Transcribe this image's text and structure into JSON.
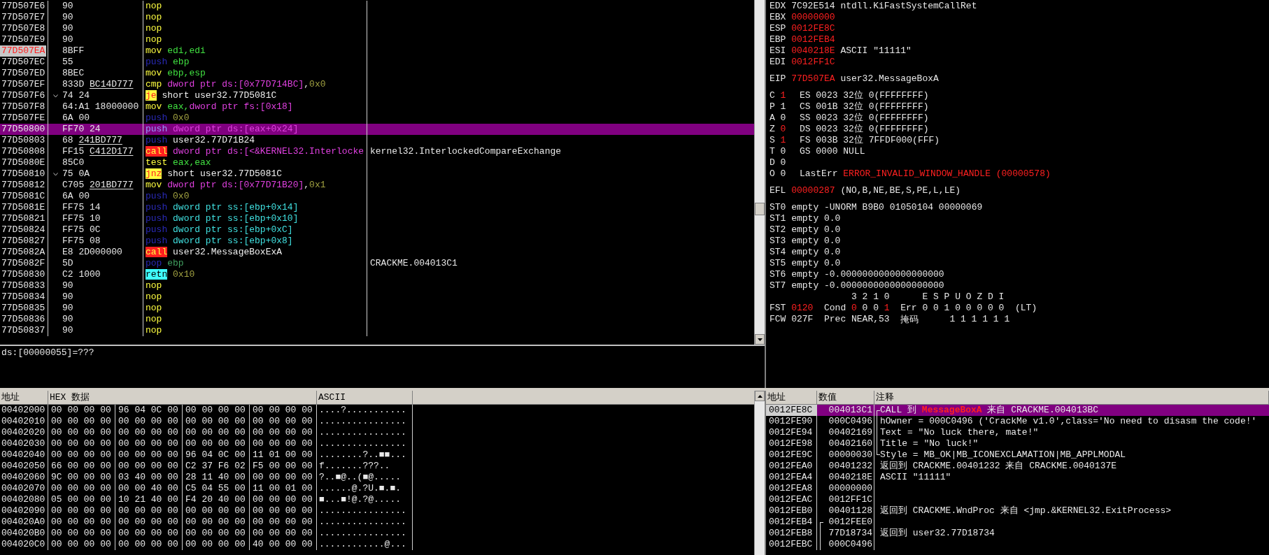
{
  "disassembly": [
    {
      "address": "77D507E6",
      "hex": [
        {
          "text": "90",
          "underline": false
        }
      ],
      "jump_mark": false,
      "eip": false,
      "selected": false,
      "mnemonic": {
        "text": "nop",
        "kind": "op"
      }
    },
    {
      "address": "77D507E7",
      "hex": [
        {
          "text": "90",
          "underline": false
        }
      ],
      "jump_mark": false,
      "eip": false,
      "selected": false,
      "mnemonic": {
        "text": "nop",
        "kind": "op"
      }
    },
    {
      "address": "77D507E8",
      "hex": [
        {
          "text": "90",
          "underline": false
        }
      ],
      "jump_mark": false,
      "eip": false,
      "selected": false,
      "mnemonic": {
        "text": "nop",
        "kind": "op"
      }
    },
    {
      "address": "77D507E9",
      "hex": [
        {
          "text": "90",
          "underline": false
        }
      ],
      "jump_mark": false,
      "eip": false,
      "selected": false,
      "mnemonic": {
        "text": "nop",
        "kind": "op"
      }
    },
    {
      "address": "77D507EA",
      "hex": [
        {
          "text": "8BFF",
          "underline": false
        }
      ],
      "jump_mark": false,
      "eip": true,
      "selected": false,
      "mnemonic": {
        "text": "mov",
        "kind": "op"
      },
      "operands": [
        {
          "text": "edi,edi",
          "kind": "reg"
        }
      ]
    },
    {
      "address": "77D507EC",
      "hex": [
        {
          "text": "55",
          "underline": false
        }
      ],
      "jump_mark": false,
      "eip": false,
      "selected": false,
      "mnemonic": {
        "text": "push",
        "kind": "stack"
      },
      "operands": [
        {
          "text": "ebp",
          "kind": "reg"
        }
      ]
    },
    {
      "address": "77D507ED",
      "hex": [
        {
          "text": "8BEC",
          "underline": false
        }
      ],
      "jump_mark": false,
      "eip": false,
      "selected": false,
      "mnemonic": {
        "text": "mov",
        "kind": "op"
      },
      "operands": [
        {
          "text": "ebp,esp",
          "kind": "reg"
        }
      ]
    },
    {
      "address": "77D507EF",
      "hex": [
        {
          "text": "833D",
          "underline": false
        },
        {
          "text": "BC14D777",
          "underline": true
        }
      ],
      "jump_mark": false,
      "eip": false,
      "selected": false,
      "mnemonic": {
        "text": "cmp",
        "kind": "op"
      },
      "operands": [
        {
          "text": "dword ptr ds:[0x77D714BC]",
          "kind": "mem"
        },
        {
          "text": ",",
          "kind": "plain"
        },
        {
          "text": "0x0",
          "kind": "const"
        }
      ]
    },
    {
      "address": "77D507F6",
      "hex": [
        {
          "text": "74 24",
          "underline": false
        }
      ],
      "jump_mark": true,
      "eip": false,
      "selected": false,
      "mnemonic": {
        "text": "je",
        "kind": "jump"
      },
      "operands": [
        {
          "text": "short user32.77D5081C",
          "kind": "label"
        }
      ]
    },
    {
      "address": "77D507F8",
      "hex": [
        {
          "text": "64:A1 18000000",
          "underline": false
        }
      ],
      "jump_mark": false,
      "eip": false,
      "selected": false,
      "mnemonic": {
        "text": "mov",
        "kind": "op"
      },
      "operands": [
        {
          "text": "eax,",
          "kind": "reg"
        },
        {
          "text": "dword ptr fs:[0x18]",
          "kind": "mem"
        }
      ]
    },
    {
      "address": "77D507FE",
      "hex": [
        {
          "text": "6A 00",
          "underline": false
        }
      ],
      "jump_mark": false,
      "eip": false,
      "selected": false,
      "mnemonic": {
        "text": "push",
        "kind": "stack"
      },
      "operands": [
        {
          "text": "0x0",
          "kind": "const"
        }
      ]
    },
    {
      "address": "77D50800",
      "hex": [
        {
          "text": "FF70 24",
          "underline": false
        }
      ],
      "jump_mark": false,
      "eip": false,
      "selected": true,
      "mnemonic": {
        "text": "push",
        "kind": "stack"
      },
      "operands": [
        {
          "text": "dword ptr ds:[eax+0x24]",
          "kind": "mem"
        }
      ]
    },
    {
      "address": "77D50803",
      "hex": [
        {
          "text": "68",
          "underline": false
        },
        {
          "text": "241BD777",
          "underline": true
        }
      ],
      "jump_mark": false,
      "eip": false,
      "selected": false,
      "mnemonic": {
        "text": "push",
        "kind": "stack"
      },
      "operands": [
        {
          "text": "user32.77D71B24",
          "kind": "label"
        }
      ]
    },
    {
      "address": "77D50808",
      "hex": [
        {
          "text": "FF15",
          "underline": false
        },
        {
          "text": "C412D177",
          "underline": true
        }
      ],
      "jump_mark": false,
      "eip": false,
      "selected": false,
      "mnemonic": {
        "text": "call",
        "kind": "call"
      },
      "operands": [
        {
          "text": "dword ptr ds:[<&KERNEL32.Interlocke",
          "kind": "mem"
        }
      ],
      "comment": "kernel32.InterlockedCompareExchange"
    },
    {
      "address": "77D5080E",
      "hex": [
        {
          "text": "85C0",
          "underline": false
        }
      ],
      "jump_mark": false,
      "eip": false,
      "selected": false,
      "mnemonic": {
        "text": "test",
        "kind": "op"
      },
      "operands": [
        {
          "text": "eax,eax",
          "kind": "reg"
        }
      ]
    },
    {
      "address": "77D50810",
      "hex": [
        {
          "text": "75 0A",
          "underline": false
        }
      ],
      "jump_mark": true,
      "eip": false,
      "selected": false,
      "mnemonic": {
        "text": "jnz",
        "kind": "jump"
      },
      "operands": [
        {
          "text": "short user32.77D5081C",
          "kind": "label"
        }
      ]
    },
    {
      "address": "77D50812",
      "hex": [
        {
          "text": "C705",
          "underline": false
        },
        {
          "text": "201BD777",
          "underline": true
        }
      ],
      "jump_mark": false,
      "eip": false,
      "selected": false,
      "mnemonic": {
        "text": "mov",
        "kind": "op"
      },
      "operands": [
        {
          "text": "dword ptr ds:[0x77D71B20]",
          "kind": "mem"
        },
        {
          "text": ",",
          "kind": "plain"
        },
        {
          "text": "0x1",
          "kind": "const"
        }
      ]
    },
    {
      "address": "77D5081C",
      "hex": [
        {
          "text": "6A 00",
          "underline": false
        }
      ],
      "jump_mark": false,
      "eip": false,
      "selected": false,
      "mnemonic": {
        "text": "push",
        "kind": "stack"
      },
      "operands": [
        {
          "text": "0x0",
          "kind": "const"
        }
      ]
    },
    {
      "address": "77D5081E",
      "hex": [
        {
          "text": "FF75 14",
          "underline": false
        }
      ],
      "jump_mark": false,
      "eip": false,
      "selected": false,
      "mnemonic": {
        "text": "push",
        "kind": "stack"
      },
      "operands": [
        {
          "text": "dword ptr ss:[ebp+0x14]",
          "kind": "ss"
        }
      ]
    },
    {
      "address": "77D50821",
      "hex": [
        {
          "text": "FF75 10",
          "underline": false
        }
      ],
      "jump_mark": false,
      "eip": false,
      "selected": false,
      "mnemonic": {
        "text": "push",
        "kind": "stack"
      },
      "operands": [
        {
          "text": "dword ptr ss:[ebp+0x10]",
          "kind": "ss"
        }
      ]
    },
    {
      "address": "77D50824",
      "hex": [
        {
          "text": "FF75 0C",
          "underline": false
        }
      ],
      "jump_mark": false,
      "eip": false,
      "selected": false,
      "mnemonic": {
        "text": "push",
        "kind": "stack"
      },
      "operands": [
        {
          "text": "dword ptr ss:[ebp+0xC]",
          "kind": "ss"
        }
      ]
    },
    {
      "address": "77D50827",
      "hex": [
        {
          "text": "FF75 08",
          "underline": false
        }
      ],
      "jump_mark": false,
      "eip": false,
      "selected": false,
      "mnemonic": {
        "text": "push",
        "kind": "stack"
      },
      "operands": [
        {
          "text": "dword ptr ss:[ebp+0x8]",
          "kind": "ss"
        }
      ]
    },
    {
      "address": "77D5082A",
      "hex": [
        {
          "text": "E8 2D000000",
          "underline": false
        }
      ],
      "jump_mark": false,
      "eip": false,
      "selected": false,
      "mnemonic": {
        "text": "call",
        "kind": "call"
      },
      "operands": [
        {
          "text": "user32.MessageBoxExA",
          "kind": "label"
        }
      ]
    },
    {
      "address": "77D5082F",
      "hex": [
        {
          "text": "5D",
          "underline": false
        }
      ],
      "jump_mark": false,
      "eip": false,
      "selected": false,
      "mnemonic": {
        "text": "pop",
        "kind": "stack"
      },
      "operands": [
        {
          "text": "ebp",
          "kind": "dimreg"
        }
      ],
      "comment": "CRACKME.004013C1"
    },
    {
      "address": "77D50830",
      "hex": [
        {
          "text": "C2 1000",
          "underline": false
        }
      ],
      "jump_mark": false,
      "eip": false,
      "selected": false,
      "mnemonic": {
        "text": "retn",
        "kind": "ret"
      },
      "operands": [
        {
          "text": "0x10",
          "kind": "const"
        }
      ]
    },
    {
      "address": "77D50833",
      "hex": [
        {
          "text": "90",
          "underline": false
        }
      ],
      "jump_mark": false,
      "eip": false,
      "selected": false,
      "mnemonic": {
        "text": "nop",
        "kind": "op"
      }
    },
    {
      "address": "77D50834",
      "hex": [
        {
          "text": "90",
          "underline": false
        }
      ],
      "jump_mark": false,
      "eip": false,
      "selected": false,
      "mnemonic": {
        "text": "nop",
        "kind": "op"
      }
    },
    {
      "address": "77D50835",
      "hex": [
        {
          "text": "90",
          "underline": false
        }
      ],
      "jump_mark": false,
      "eip": false,
      "selected": false,
      "mnemonic": {
        "text": "nop",
        "kind": "op"
      }
    },
    {
      "address": "77D50836",
      "hex": [
        {
          "text": "90",
          "underline": false
        }
      ],
      "jump_mark": false,
      "eip": false,
      "selected": false,
      "mnemonic": {
        "text": "nop",
        "kind": "op"
      }
    },
    {
      "address": "77D50837",
      "hex": [
        {
          "text": "90",
          "underline": false
        }
      ],
      "jump_mark": false,
      "eip": false,
      "selected": false,
      "mnemonic": {
        "text": "nop",
        "kind": "op"
      }
    }
  ],
  "info_line": "ds:[00000055]=???",
  "registers": [
    {
      "name": "EDX",
      "value": "7C92E514",
      "changed": false,
      "comment": "ntdll.KiFastSystemCallRet"
    },
    {
      "name": "EBX",
      "value": "00000000",
      "changed": true
    },
    {
      "name": "ESP",
      "value": "0012FE8C",
      "changed": true
    },
    {
      "name": "EBP",
      "value": "0012FEB4",
      "changed": true
    },
    {
      "name": "ESI",
      "value": "0040218E",
      "changed": true,
      "comment": "ASCII \"11111\""
    },
    {
      "name": "EDI",
      "value": "0012FF1C",
      "changed": true
    }
  ],
  "eip": {
    "name": "EIP",
    "value": "77D507EA",
    "changed": true,
    "comment": "user32.MessageBoxA"
  },
  "flags": [
    {
      "flag": "C",
      "value": "1",
      "changed": true,
      "detail": "ES 0023 32位 0(FFFFFFFF)",
      "detail_changed": false
    },
    {
      "flag": "P",
      "value": "1",
      "changed": false,
      "detail": "CS 001B 32位 0(FFFFFFFF)",
      "detail_changed": false
    },
    {
      "flag": "A",
      "value": "0",
      "changed": false,
      "detail": "SS 0023 32位 0(FFFFFFFF)",
      "detail_changed": false
    },
    {
      "flag": "Z",
      "value": "0",
      "changed": true,
      "detail": "DS 0023 32位 0(FFFFFFFF)",
      "detail_changed": false
    },
    {
      "flag": "S",
      "value": "1",
      "changed": true,
      "detail": "FS 003B 32位 7FFDF000(FFF)",
      "detail_changed": false
    },
    {
      "flag": "T",
      "value": "0",
      "changed": false,
      "detail": "GS 0000 NULL",
      "detail_changed": false
    },
    {
      "flag": "D",
      "value": "0",
      "changed": false
    },
    {
      "flag": "O",
      "value": "0",
      "changed": false,
      "label": "LastErr",
      "detail": "ERROR_INVALID_WINDOW_HANDLE (00000578)",
      "detail_changed": true
    }
  ],
  "efl": {
    "name": "EFL",
    "value": "00000287",
    "changed": true,
    "comment": "(NO,B,NE,BE,S,PE,L,LE)"
  },
  "fpu_stack": [
    "ST0 empty -UNORM B9B0 01050104 00000069",
    "ST1 empty 0.0",
    "ST2 empty 0.0",
    "ST3 empty 0.0",
    "ST4 empty 0.0",
    "ST5 empty 0.0",
    "ST6 empty -0.0000000000000000000",
    "ST7 empty -0.0000000000000000000"
  ],
  "fpu_status": {
    "cond_header": "3 2 1 0",
    "err_header": "E S P U O Z D I",
    "fst": {
      "label": "FST",
      "value": "0120",
      "changed": true,
      "cond_label": "Cond",
      "cond_bits": [
        {
          "value": "0",
          "changed": true
        },
        {
          "value": "0",
          "changed": false
        },
        {
          "value": "0",
          "changed": false
        },
        {
          "value": "1",
          "changed": true
        }
      ],
      "err_label": "Err",
      "err_bits": "0 0 1 0 0 0 0 0",
      "flag_text": "(LT)"
    },
    "fcw": {
      "label": "FCW",
      "value": "027F",
      "changed": false,
      "prec_label": "Prec",
      "prec": "NEAR,53",
      "mask_label": "掩码",
      "mask_bits": "1 1 1 1 1 1"
    }
  },
  "dump": {
    "columns": [
      "地址",
      "HEX 数据",
      "ASCII"
    ],
    "rows": [
      {
        "address": "00402000",
        "groups": [
          "00 00 00 00",
          "96 04 0C 00",
          "00 00 00 00",
          "00 00 00 00"
        ],
        "ascii": "....?..........."
      },
      {
        "address": "00402010",
        "groups": [
          "00 00 00 00",
          "00 00 00 00",
          "00 00 00 00",
          "00 00 00 00"
        ],
        "ascii": "................"
      },
      {
        "address": "00402020",
        "groups": [
          "00 00 00 00",
          "00 00 00 00",
          "00 00 00 00",
          "00 00 00 00"
        ],
        "ascii": "................"
      },
      {
        "address": "00402030",
        "groups": [
          "00 00 00 00",
          "00 00 00 00",
          "00 00 00 00",
          "00 00 00 00"
        ],
        "ascii": "................"
      },
      {
        "address": "00402040",
        "groups": [
          "00 00 00 00",
          "00 00 00 00",
          "96 04 0C 00",
          "11 01 00 00"
        ],
        "ascii": "........?..■■..."
      },
      {
        "address": "00402050",
        "groups": [
          "66 00 00 00",
          "00 00 00 00",
          "C2 37 F6 02",
          "F5 00 00 00"
        ],
        "ascii": "f.......???.."
      },
      {
        "address": "00402060",
        "groups": [
          "9C 00 00 00",
          "03 40 00 00",
          "28 11 40 00",
          "00 00 00 00"
        ],
        "ascii": "?..■@..(■@....."
      },
      {
        "address": "00402070",
        "groups": [
          "00 00 00 00",
          "00 00 40 00",
          "C5 04 55 00",
          "11 00 01 00"
        ],
        "ascii": "......@.?U.■.■."
      },
      {
        "address": "00402080",
        "groups": [
          "05 00 00 00",
          "10 21 40 00",
          "F4 20 40 00",
          "00 00 00 00"
        ],
        "ascii": "■...■!@.?@....."
      },
      {
        "address": "00402090",
        "groups": [
          "00 00 00 00",
          "00 00 00 00",
          "00 00 00 00",
          "00 00 00 00"
        ],
        "ascii": "................"
      },
      {
        "address": "004020A0",
        "groups": [
          "00 00 00 00",
          "00 00 00 00",
          "00 00 00 00",
          "00 00 00 00"
        ],
        "ascii": "................"
      },
      {
        "address": "004020B0",
        "groups": [
          "00 00 00 00",
          "00 00 00 00",
          "00 00 00 00",
          "00 00 00 00"
        ],
        "ascii": "................"
      },
      {
        "address": "004020C0",
        "groups": [
          "00 00 00 00",
          "00 00 00 00",
          "00 00 00 00",
          "40 00 00 00"
        ],
        "ascii": "............@..."
      }
    ]
  },
  "stack": {
    "columns": [
      "地址",
      "数值",
      "注释"
    ],
    "rows": [
      {
        "address": "0012FE8C",
        "value": "004013C1",
        "selected": true,
        "frame": {
          "kind": "start"
        },
        "comment": [
          {
            "text": "CALL 到",
            "kind": "plain"
          },
          {
            "text": "MessageBoxA",
            "kind": "alert"
          },
          {
            "text": "来自 CRACKME.004013BC",
            "kind": "plain"
          }
        ]
      },
      {
        "address": "0012FE90",
        "value": "000C0496",
        "selected": false,
        "frame": {
          "kind": "mid"
        },
        "comment": [
          {
            "text": "hOwner = 000C0496 ('CrackMe v1.0',class='No need to disasm the code!'",
            "kind": "plain"
          }
        ]
      },
      {
        "address": "0012FE94",
        "value": "00402169",
        "selected": false,
        "frame": {
          "kind": "mid"
        },
        "comment": [
          {
            "text": "Text = \"No luck there, mate!\"",
            "kind": "plain"
          }
        ]
      },
      {
        "address": "0012FE98",
        "value": "00402160",
        "selected": false,
        "frame": {
          "kind": "mid"
        },
        "comment": [
          {
            "text": "Title = \"No luck!\"",
            "kind": "plain"
          }
        ]
      },
      {
        "address": "0012FE9C",
        "value": "00000030",
        "selected": false,
        "frame": {
          "kind": "end"
        },
        "comment": [
          {
            "text": "Style = MB_OK|MB_ICONEXCLAMATION|MB_APPLMODAL",
            "kind": "plain"
          }
        ]
      },
      {
        "address": "0012FEA0",
        "value": "00401232",
        "selected": false,
        "comment": [
          {
            "text": "返回到 CRACKME.00401232 来自 CRACKME.0040137E",
            "kind": "plain"
          }
        ]
      },
      {
        "address": "0012FEA4",
        "value": "0040218E",
        "selected": false,
        "comment": [
          {
            "text": "ASCII \"11111\"",
            "kind": "plain"
          }
        ]
      },
      {
        "address": "0012FEA8",
        "value": "00000000",
        "selected": false
      },
      {
        "address": "0012FEAC",
        "value": "0012FF1C",
        "selected": false
      },
      {
        "address": "0012FEB0",
        "value": "00401128",
        "selected": false,
        "comment": [
          {
            "text": "返回到 CRACKME.WndProc 来自 <jmp.&KERNEL32.ExitProcess>",
            "kind": "plain"
          }
        ]
      },
      {
        "address": "0012FEB4",
        "value": "0012FEE0",
        "selected": false,
        "value_frame": {
          "kind": "start"
        }
      },
      {
        "address": "0012FEB8",
        "value": "77D18734",
        "selected": false,
        "value_frame": {
          "kind": "mid"
        },
        "comment": [
          {
            "text": "返回到 user32.77D18734",
            "kind": "plain"
          }
        ]
      },
      {
        "address": "0012FEBC",
        "value": "000C0496",
        "selected": false,
        "value_frame": {
          "kind": "mid"
        }
      }
    ]
  }
}
